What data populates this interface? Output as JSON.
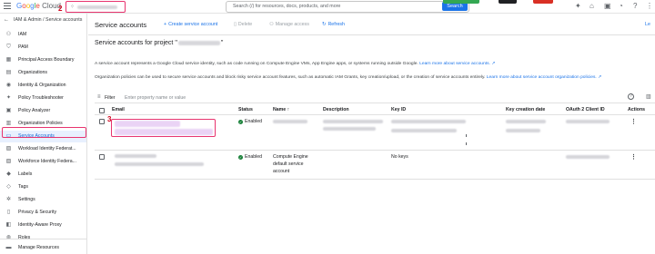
{
  "header": {
    "logo": {
      "g1": "G",
      "g2": "o",
      "g3": "o",
      "g4": "g",
      "g5": "l",
      "g6": "e",
      "cloud": "Cloud"
    },
    "project_badge": "2",
    "project_selector_icon": "project-dots-icon",
    "search_placeholder": "Search (/) for resources, docs, products, and more",
    "search_button": "Search",
    "icons": [
      "gemini-icon",
      "gift-icon",
      "terminal-icon",
      "bell-icon",
      "help-icon",
      "more-vert-icon"
    ]
  },
  "breadcrumb": {
    "back": "←",
    "text": "IAM & Admin  /  Service accounts"
  },
  "sidebar": {
    "items": [
      {
        "label": "IAM",
        "icon": "person-plus-icon",
        "glyph": "⚇"
      },
      {
        "label": "PAM",
        "icon": "shield-icon",
        "glyph": "⛉"
      },
      {
        "label": "Principal Access Boundary",
        "icon": "boundary-icon",
        "glyph": "▦"
      },
      {
        "label": "Organizations",
        "icon": "organization-icon",
        "glyph": "▤"
      },
      {
        "label": "Identity & Organization",
        "icon": "identity-icon",
        "glyph": "◉"
      },
      {
        "label": "Policy Troubleshooter",
        "icon": "wrench-icon",
        "glyph": "✦"
      },
      {
        "label": "Policy Analyzer",
        "icon": "analyzer-icon",
        "glyph": "▣"
      },
      {
        "label": "Organization Policies",
        "icon": "policy-doc-icon",
        "glyph": "▥"
      },
      {
        "label": "Service Accounts",
        "icon": "service-account-icon",
        "glyph": "▭"
      },
      {
        "label": "Workload Identity Federat...",
        "icon": "workload-icon",
        "glyph": "▨"
      },
      {
        "label": "Workforce Identity Federa...",
        "icon": "workforce-icon",
        "glyph": "▧"
      },
      {
        "label": "Labels",
        "icon": "label-icon",
        "glyph": "◆"
      },
      {
        "label": "Tags",
        "icon": "tag-icon",
        "glyph": "◇"
      },
      {
        "label": "Settings",
        "icon": "gear-icon",
        "glyph": "✲"
      },
      {
        "label": "Privacy & Security",
        "icon": "lock-icon",
        "glyph": "▯"
      },
      {
        "label": "Identity-Aware Proxy",
        "icon": "proxy-icon",
        "glyph": "◧"
      },
      {
        "label": "Roles",
        "icon": "roles-icon",
        "glyph": "◍"
      }
    ],
    "bottom_item": {
      "label": "Manage Resources",
      "icon": "folder-icon",
      "glyph": "▬"
    }
  },
  "toolbar": {
    "title": "Service accounts",
    "create": {
      "icon": "+",
      "label": "Create service account"
    },
    "delete": {
      "icon": "🗑",
      "label": "Delete"
    },
    "manage_access": {
      "icon": "⚇",
      "label": "Manage access"
    },
    "refresh": {
      "icon": "↻",
      "label": "Refresh"
    },
    "learn": "Le"
  },
  "content": {
    "subtitle_prefix": "Service accounts for project \"",
    "subtitle_suffix": "\"",
    "desc1": "A service account represents a Google Cloud service identity, such as code running on Compute Engine VMs, App Engine apps, or systems running outside Google.",
    "desc1_link": "Learn more about service accounts. ↗",
    "desc2": "Organization policies can be used to secure service accounts and block risky service account features, such as automatic IAM Grants, key creation/upload, or the creation of service accounts entirely.",
    "desc2_link": "Learn more about service account organization policies. ↗"
  },
  "filter": {
    "label": "Filter",
    "placeholder": "Enter property name or value",
    "help": "?"
  },
  "table": {
    "headers": [
      "Email",
      "Status",
      "Name",
      "Description",
      "Key ID",
      "Key creation date",
      "OAuth 2 Client ID",
      "Actions"
    ],
    "sort_arrow": "↑",
    "rows": [
      {
        "status": "Enabled",
        "name": "",
        "description": "",
        "key_id": "",
        "key_date": "",
        "oauth": ""
      },
      {
        "status": "Enabled",
        "name": "Compute Engine default service account",
        "name_l1": "Compute Engine",
        "name_l2": "default service",
        "name_l3": "account",
        "description": "",
        "key_id": "No keys",
        "key_date": "",
        "oauth": ""
      }
    ],
    "row_badge": "3",
    "kebab": "⋮"
  },
  "colors": {
    "accent": "#1a73e8",
    "highlight": "#e8346f",
    "enabled": "#188038"
  }
}
